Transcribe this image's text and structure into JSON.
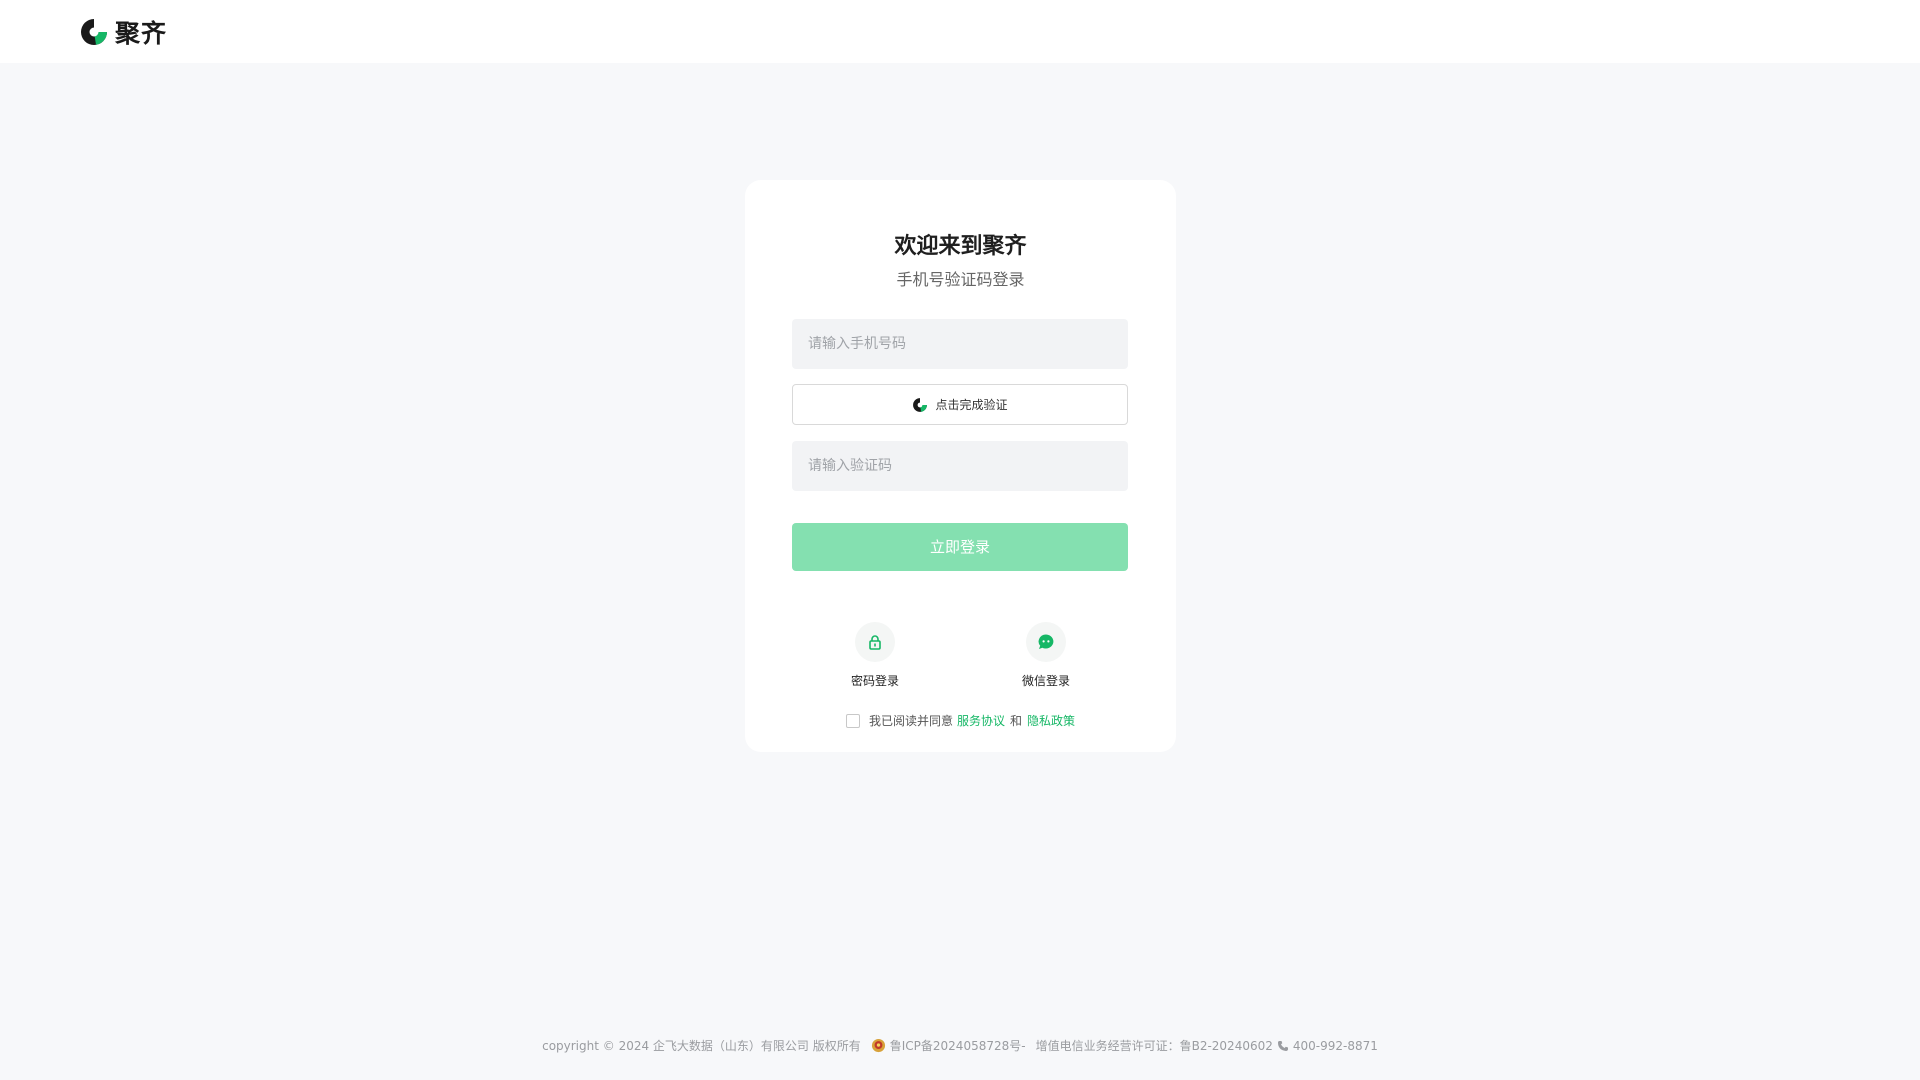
{
  "brand": {
    "name": "聚齐",
    "accent": "#16b766",
    "dark": "#1a1a1a"
  },
  "card": {
    "title": "欢迎来到聚齐",
    "subtitle": "手机号验证码登录",
    "phone_placeholder": "请输入手机号码",
    "verify_label": "点击完成验证",
    "code_placeholder": "请输入验证码",
    "login_label": "立即登录",
    "alt_methods": [
      {
        "label": "密码登录",
        "icon": "lock-icon"
      },
      {
        "label": "微信登录",
        "icon": "chat-bubble-icon"
      }
    ],
    "agreement": {
      "prefix": "我已阅读并同意",
      "service": "服务协议",
      "and": "和",
      "privacy": "隐私政策",
      "checked": false
    }
  },
  "footer": {
    "copyright": "copyright © 2024 企飞大数据（山东）有限公司 版权所有",
    "icp": "鲁ICP备2024058728号-",
    "license": "增值电信业务经营许可证：鲁B2-20240602",
    "phone": "400-992-8871"
  }
}
